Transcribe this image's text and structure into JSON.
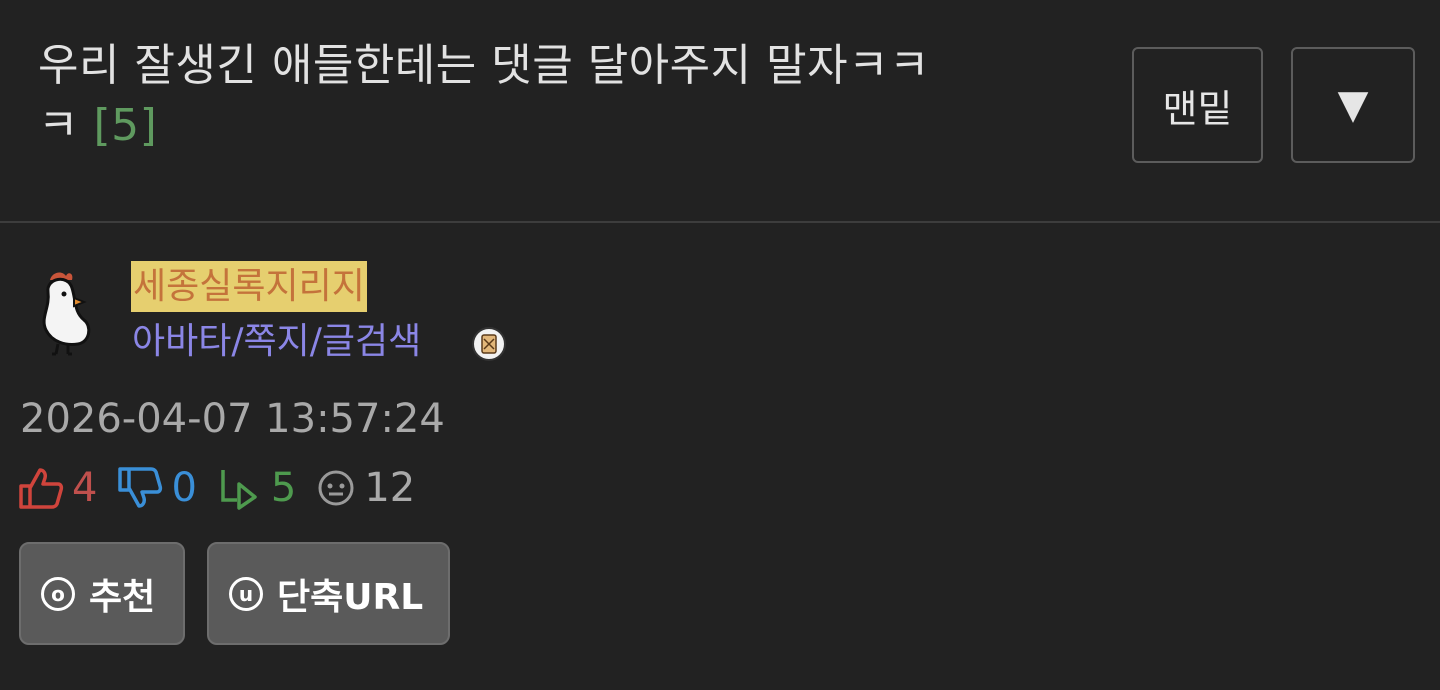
{
  "post": {
    "title": "우리 잘생긴 애들한테는 댓글 달아주지 말자ㅋㅋㅋ",
    "comment_count": "[5]"
  },
  "header_buttons": {
    "bottom_label": "맨밑",
    "down_label": "▼"
  },
  "author": {
    "nickname": "세종실록지리지",
    "links": "아바타/쪽지/글검색",
    "avatar_icon": "chicken-avatar-icon",
    "badge_icon": "scroll-badge-icon"
  },
  "date": "2026-04-07 13:57:24",
  "stats": {
    "upvotes": "4",
    "downvotes": "0",
    "replies": "5",
    "views": "12"
  },
  "actions": {
    "recommend_icon_letter": "o",
    "recommend_label": "추천",
    "shorturl_icon_letter": "u",
    "shorturl_label": "단축URL"
  },
  "colors": {
    "background": "#222222",
    "title_text": "#e2e2e2",
    "comment_count": "#5f9a5f",
    "nickname_bg": "#e6cf6f",
    "nickname_text": "#c4733b",
    "links": "#8b86e6",
    "upvote": "#c0504d",
    "downvote": "#3a8fd8",
    "reply": "#4e9a4e",
    "view": "#aaaaaa",
    "action_button_bg": "#5a5a5a"
  }
}
